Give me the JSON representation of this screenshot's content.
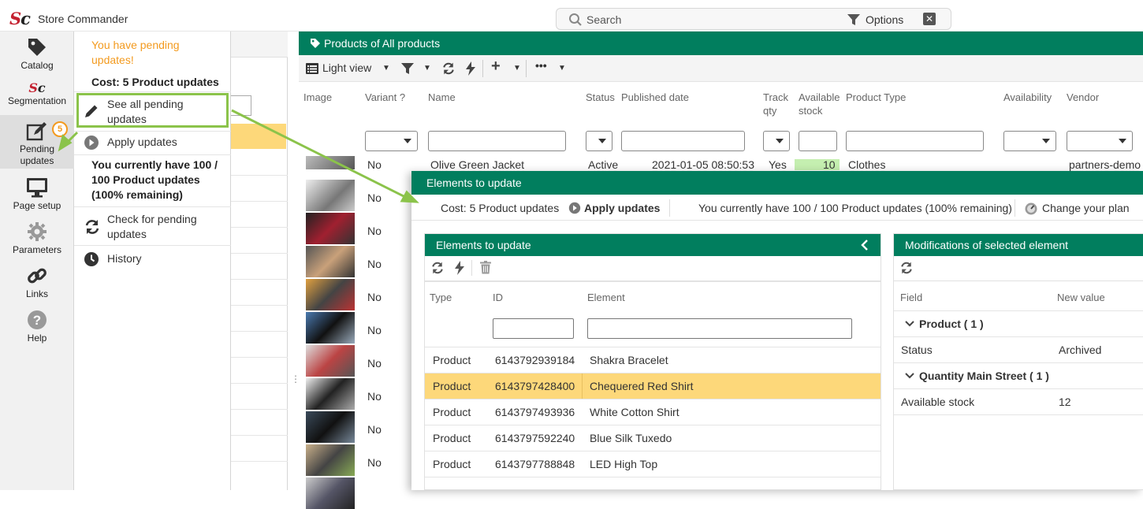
{
  "app": {
    "title": "Store Commander",
    "logo_text": "Sc"
  },
  "search": {
    "placeholder": "Search",
    "options_label": "Options"
  },
  "leftnav": {
    "items": [
      {
        "label": "Catalog"
      },
      {
        "label": "Segmentation"
      },
      {
        "label": "Pending updates",
        "badge": "5"
      },
      {
        "label": "Page setup"
      },
      {
        "label": "Parameters"
      },
      {
        "label": "Links"
      },
      {
        "label": "Help"
      }
    ]
  },
  "pending_menu": {
    "warning": "You have pending updates!",
    "cost": "Cost: 5 Product updates",
    "see_all": "See all pending updates",
    "apply": "Apply updates",
    "quota": "You currently have 100 / 100 Product updates (100% remaining)",
    "check": "Check for pending updates",
    "history": "History"
  },
  "products_panel": {
    "title": "Products of All products",
    "toolbar": {
      "view_label": "Light view"
    },
    "columns": [
      "Image",
      "Variant ?",
      "Name",
      "Status",
      "Published date",
      "Track qty",
      "Available stock",
      "Product Type",
      "Availability",
      "Vendor"
    ],
    "first_row": {
      "variant": "No",
      "name": "Olive Green Jacket",
      "status": "Active",
      "published": "2021-01-05 08:50:53",
      "track": "Yes",
      "stock": "10",
      "type": "Clothes",
      "vendor": "partners-demo"
    },
    "variant_values": [
      "No",
      "No",
      "No",
      "No",
      "No",
      "No",
      "No",
      "No",
      "No"
    ]
  },
  "modal": {
    "title": "Elements to update",
    "cost": "Cost: 5 Product updates",
    "apply": "Apply updates",
    "quota": "You currently have 100 / 100 Product updates (100% remaining)",
    "change_plan": "Change your plan",
    "elements": {
      "title": "Elements to update",
      "columns": {
        "type": "Type",
        "id": "ID",
        "element": "Element"
      },
      "rows": [
        {
          "type": "Product",
          "id": "6143792939184",
          "element": "Shakra Bracelet"
        },
        {
          "type": "Product",
          "id": "6143797428400",
          "element": "Chequered Red Shirt"
        },
        {
          "type": "Product",
          "id": "6143797493936",
          "element": "White Cotton Shirt"
        },
        {
          "type": "Product",
          "id": "6143797592240",
          "element": "Blue Silk Tuxedo"
        },
        {
          "type": "Product",
          "id": "6143797788848",
          "element": "LED High Top"
        }
      ]
    },
    "modifications": {
      "title": "Modifications of selected element",
      "columns": {
        "field": "Field",
        "new_value": "New value"
      },
      "groups": [
        {
          "label": "Product ( 1 )",
          "field": "Status",
          "value": "Archived"
        },
        {
          "label": "Quantity Main Street ( 1 )",
          "field": "Available stock",
          "value": "12"
        }
      ]
    }
  },
  "colors": {
    "brand_green": "#017e5e",
    "highlight": "#fdd87a",
    "accent_orange": "#f39a1e",
    "callout_green": "#8bc34a"
  }
}
